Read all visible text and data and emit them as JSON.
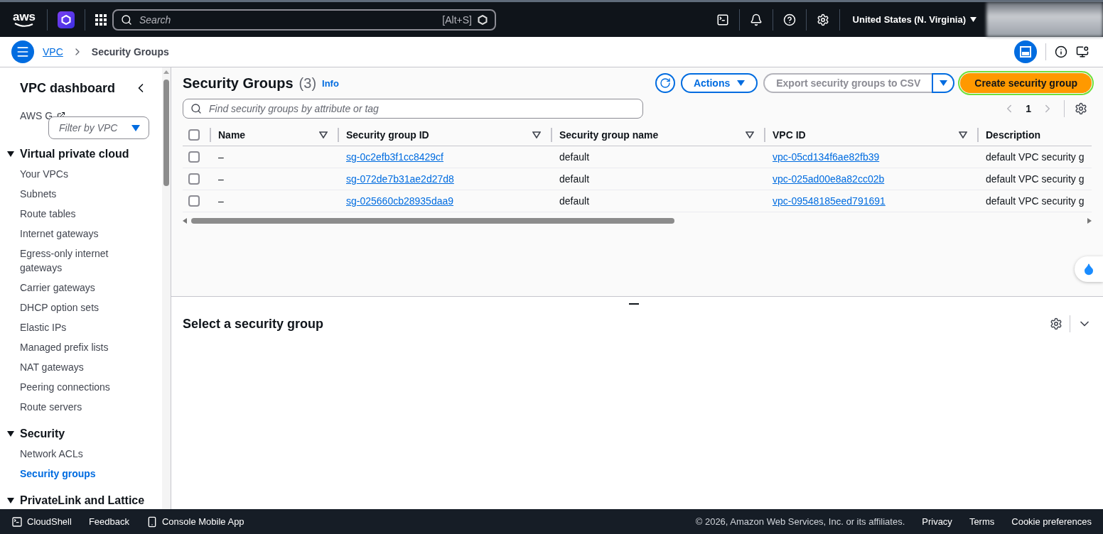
{
  "top_nav": {
    "logo_text": "aws",
    "search": {
      "placeholder": "Search"
    },
    "shortcut": "[Alt+S]",
    "region": "United States (N. Virginia)"
  },
  "breadcrumbs": [
    {
      "label": "VPC",
      "kind": "link"
    },
    {
      "label": "Security Groups",
      "kind": "current"
    }
  ],
  "sidebar": {
    "title": "VPC dashboard",
    "global_view": "AWS G",
    "filter": {
      "placeholder": "Filter by VPC"
    },
    "sections": [
      {
        "label": "Virtual private cloud",
        "expanded": true,
        "items": [
          {
            "label": "Your VPCs",
            "selected": false
          },
          {
            "label": "Subnets",
            "selected": false
          },
          {
            "label": "Route tables",
            "selected": false
          },
          {
            "label": "Internet gateways",
            "selected": false
          },
          {
            "label": "Egress-only internet gateways",
            "selected": false
          },
          {
            "label": "Carrier gateways",
            "selected": false
          },
          {
            "label": "DHCP option sets",
            "selected": false
          },
          {
            "label": "Elastic IPs",
            "selected": false
          },
          {
            "label": "Managed prefix lists",
            "selected": false
          },
          {
            "label": "NAT gateways",
            "selected": false
          },
          {
            "label": "Peering connections",
            "selected": false
          },
          {
            "label": "Route servers",
            "selected": false
          }
        ]
      },
      {
        "label": "Security",
        "expanded": true,
        "items": [
          {
            "label": "Network ACLs",
            "selected": false
          },
          {
            "label": "Security groups",
            "selected": true
          }
        ]
      },
      {
        "label": "PrivateLink and Lattice",
        "expanded": true
      }
    ]
  },
  "table": {
    "title": "Security Groups",
    "count": "(3)",
    "info": "Info",
    "actions": "Actions",
    "export": {
      "label": "Export security groups to CSV",
      "disabled": true
    },
    "create": "Create security group",
    "search": {
      "placeholder": "Find security groups by attribute or tag"
    },
    "page": "1",
    "select_all_checked": false,
    "columns": [
      {
        "label": "Name",
        "kind": "text"
      },
      {
        "label": "Security group ID",
        "kind": "link"
      },
      {
        "label": "Security group name",
        "kind": "text"
      },
      {
        "label": "VPC ID",
        "kind": "link"
      },
      {
        "label": "Description",
        "kind": "text"
      }
    ],
    "rows": [
      {
        "checked": false,
        "cells": [
          "–",
          "sg-0c2efb3f1cc8429cf",
          "default",
          "vpc-05cd134f6ae82fb39",
          "default VPC security g"
        ]
      },
      {
        "checked": false,
        "cells": [
          "–",
          "sg-072de7b31ae2d27d8",
          "default",
          "vpc-025ad00e8a82cc02b",
          "default VPC security g"
        ]
      },
      {
        "checked": false,
        "cells": [
          "–",
          "sg-025660cb28935daa9",
          "default",
          "vpc-09548185eed791691",
          "default VPC security g"
        ]
      }
    ]
  },
  "details": {
    "title": "Select a security group"
  },
  "footer": {
    "left": [
      "CloudShell",
      "Feedback",
      "Console Mobile App"
    ],
    "copyright": "© 2026, Amazon Web Services, Inc. or its affiliates.",
    "right": [
      "Privacy",
      "Terms",
      "Cookie preferences"
    ]
  }
}
